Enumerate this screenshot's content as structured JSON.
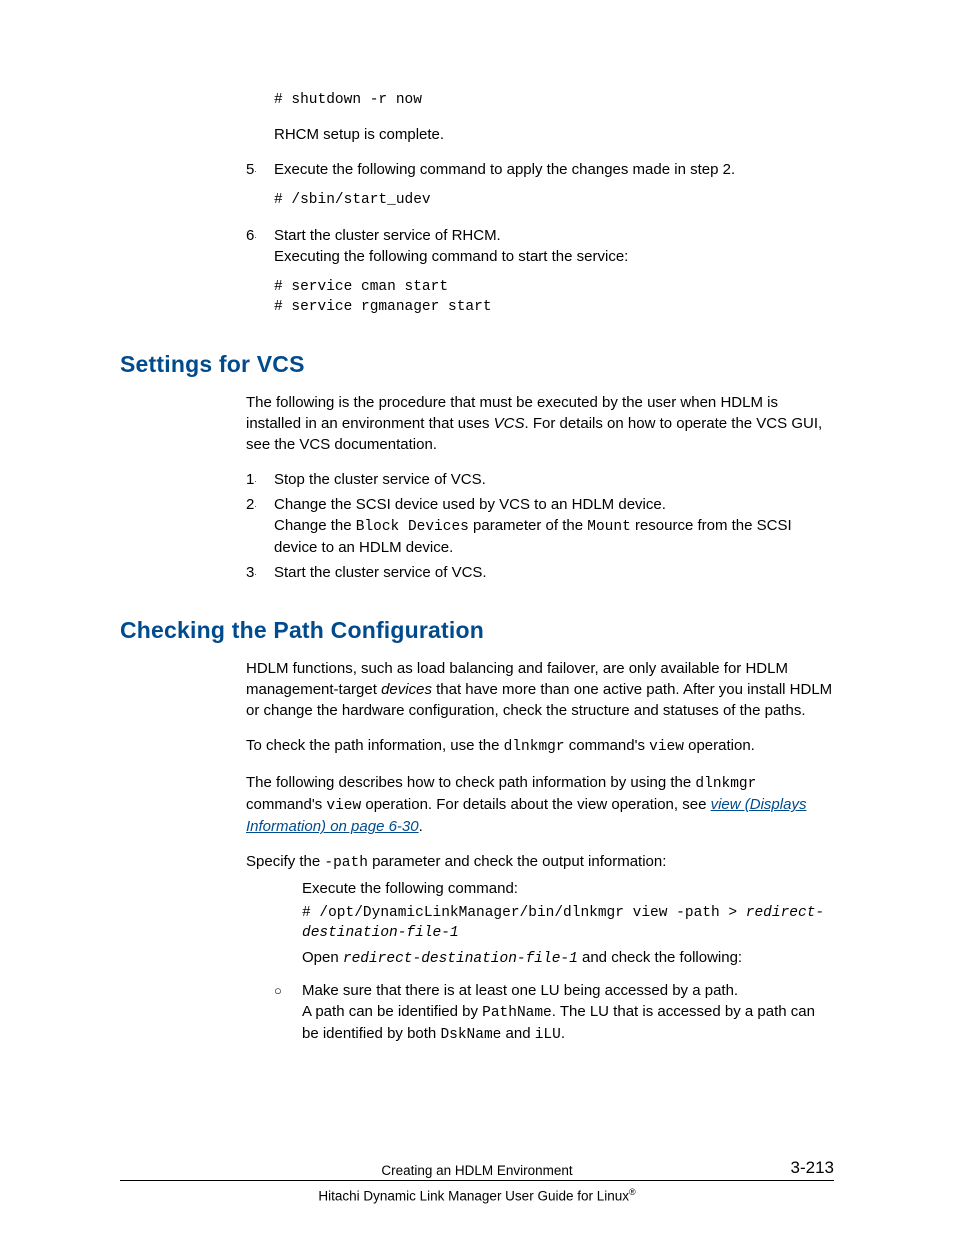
{
  "top": {
    "code1": "# shutdown -r now",
    "para1": "RHCM setup is complete.",
    "item5": {
      "num": "5",
      "text": "Execute the following command to apply the changes made in step 2."
    },
    "code2": "# /sbin/start_udev",
    "item6": {
      "num": "6",
      "line1": "Start the cluster service of RHCM.",
      "line2": "Executing the following command to start the service:"
    },
    "code3": "# service cman start\n# service rgmanager start"
  },
  "vcs": {
    "heading": "Settings for VCS",
    "intro_a": "The following is the procedure that must be executed by the user when HDLM is installed in an environment that uses ",
    "intro_vcs": "VCS",
    "intro_b": ". For details on how to operate the VCS GUI, see the VCS documentation.",
    "i1": {
      "num": "1",
      "text": "Stop the cluster service of VCS."
    },
    "i2": {
      "num": "2",
      "line1": "Change the SCSI device used by VCS to an HDLM device.",
      "line2a": "Change the ",
      "bd": "Block Devices",
      "line2b": " parameter of the ",
      "mt": "Mount",
      "line2c": " resource from the SCSI device to an HDLM device."
    },
    "i3": {
      "num": "3",
      "text": "Start the cluster service of VCS."
    }
  },
  "path": {
    "heading": "Checking the Path Configuration",
    "p1a": "HDLM functions, such as load balancing and failover, are only available for HDLM management-target ",
    "p1_dev": "devices",
    "p1b": " that have more than one active path. After you install HDLM or change the hardware configuration, check the structure and statuses of the paths.",
    "p2a": "To check the path information, use the ",
    "dlnkmgr": "dlnkmgr",
    "p2b": " command's ",
    "view": "view",
    "p2c": " operation.",
    "p3a": "The following describes how to check path information by using the ",
    "p3b": " command's ",
    "p3c": " operation. For details about the view operation, see ",
    "link": "view (Displays Information) on page 6-30",
    "p3d": ".",
    "p4a": "Specify the ",
    "pathparam": "-path",
    "p4b": " parameter and check the output information:",
    "exec": "Execute the following command:",
    "cmd_a": "# /opt/DynamicLinkManager/bin/dlnkmgr view -path > ",
    "cmd_b": "redirect-destination-file-1",
    "open_a": "Open ",
    "open_file": "redirect-destination-file-1",
    "open_b": " and check the following:",
    "b1_line1": "Make sure that there is at least one LU being accessed by a path.",
    "b1_line2a": "A path can be identified by ",
    "pathname": "PathName",
    "b1_line2b": ". The LU that is accessed by a path can be identified by both ",
    "dskname": "DskName",
    "b1_line2c": " and ",
    "ilu": "iLU",
    "b1_line2d": "."
  },
  "footer": {
    "title": "Creating an HDLM Environment",
    "page": "3-213",
    "sub_a": "Hitachi Dynamic Link Manager User Guide for Linux",
    "sub_r": "®"
  }
}
